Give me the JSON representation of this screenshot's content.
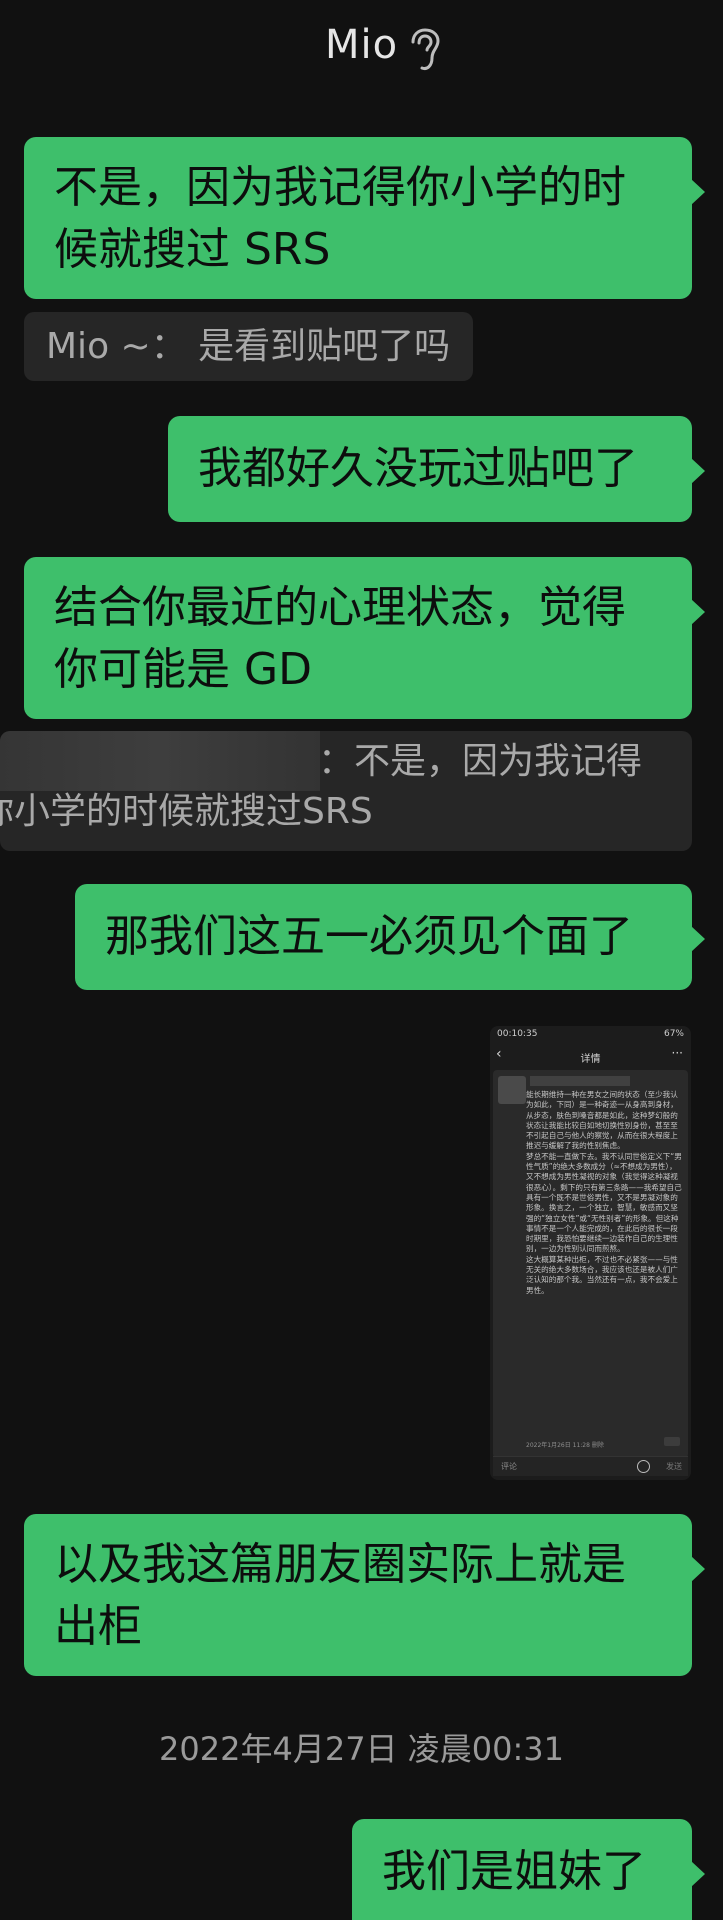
{
  "header": {
    "title": "Mio",
    "icon": "ear-icon"
  },
  "messages": {
    "m1": [
      "不是，因为我记得你小学的时",
      "候就搜过 SRS"
    ],
    "q1": "Mio ~： 是看到贴吧了吗",
    "m2": "我都好久没玩过贴吧了",
    "m3": [
      "结合你最近的心理状态，觉得",
      "你可能是 GD"
    ],
    "q2": [
      "：不是，因为我记得",
      "你小学的时候就搜过SRS"
    ],
    "m4": "那我们这五一必须见个面了",
    "m5": [
      "以及我这篇朋友圈实际上就是",
      "出柜"
    ],
    "timestamp": "2022年4月27日 凌晨00:31",
    "m6": "我们是姐妹了"
  },
  "screenshot": {
    "time": "00:10:35",
    "battery": "67%",
    "title": "详情",
    "post": "能长期维持一种在男女之间的状态（至少我认为如此，下同）是一种奇迹一从身高到身材，从步态，肤色到嗓音都是如此，这种梦幻般的状态让我能比较自如地切换性别身份，甚至至不引起自己与他人的察觉，从而在很大程度上推迟与缓解了我的性别焦虑。\n梦总不能一直做下去。我不认同世俗定义下“男性气质”的绝大多数成分（≈不想成为男性），又不想成为男性凝视的对象（我觉得这种凝视很恶心）。剩下的只有第三条路——我希望自己具有一个既不是世俗男性，又不是男凝对象的形象。换言之，一个独立，智慧，敏感而又坚强的“独立女性”或“无性别者”的形象。但这种事情不是一个人能完成的，在此后的很长一段时期里，我恐怕要继续一边装作自己的生理性别，一边为性别认同而煎熬。\n这大概算某种出柜，不过也不必紧张——与性无关的绝大多数场合，我应该也还是被人们广泛认知的那个我。当然还有一点，我不会爱上男性。",
    "date": "2022年1月26日 11:28 删除",
    "placeholder": "评论",
    "send": "发送"
  },
  "colors": {
    "bubble": "#3ebf6b",
    "background": "#111111",
    "quote": "#262626"
  }
}
